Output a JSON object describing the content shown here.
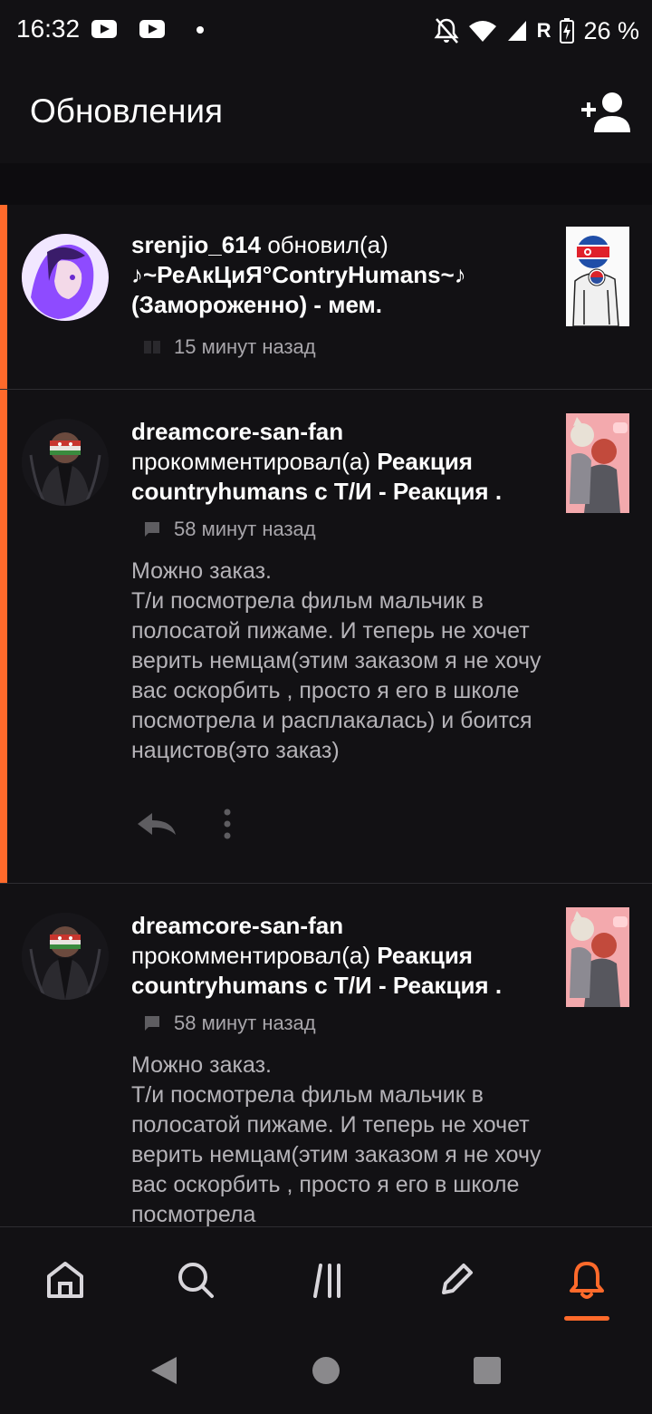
{
  "status_bar": {
    "time": "16:32",
    "battery": "26 %",
    "network_letter": "R",
    "icons": [
      "youtube-icon",
      "youtube-icon",
      "dot-icon",
      "mute-bell-icon",
      "wifi-icon",
      "signal-icon",
      "battery-charging-icon"
    ]
  },
  "header": {
    "title": "Обновления",
    "add_user_icon": "add-user-icon"
  },
  "feed": [
    {
      "unread": true,
      "user": "srenjio_614",
      "action": " обновил(а) ",
      "target": "♪~РеАкЦиЯ°ContryHumans~♪ (Замороженно) - мем.",
      "meta_icon": "book-icon",
      "time": "15 минут назад"
    },
    {
      "unread": true,
      "user": "dreamcore-san-fan",
      "action": "прокомментировал(а) ",
      "target": "Реакция countryhumans с Т/И - Реакция .",
      "meta_icon": "comment-icon",
      "time": "58 минут назад",
      "comment": "Можно заказ.\nТ/и посмотрела фильм мальчик в полосатой пижаме. И теперь не хочет верить немцам(этим заказом я не хочу вас оскорбить , просто я его в школе посмотрела и расплакалась) и боится нацистов(это заказ)"
    },
    {
      "unread": false,
      "user": "dreamcore-san-fan",
      "action": "прокомментировал(а) ",
      "target": "Реакция countryhumans с Т/И - Реакция .",
      "meta_icon": "comment-icon",
      "time": "58 минут назад",
      "comment": "Можно заказ.\nТ/и посмотрела фильм мальчик в полосатой пижаме. И теперь не хочет верить немцам(этим заказом я не хочу вас оскорбить , просто я его в школе посмотрела"
    }
  ],
  "bottom_nav": {
    "items": [
      "home-icon",
      "search-icon",
      "library-icon",
      "write-icon",
      "notifications-icon"
    ],
    "active": "notifications-icon",
    "accent": "#ff6a2b"
  },
  "system_nav": [
    "back-icon",
    "home-circle-icon",
    "recents-icon"
  ]
}
